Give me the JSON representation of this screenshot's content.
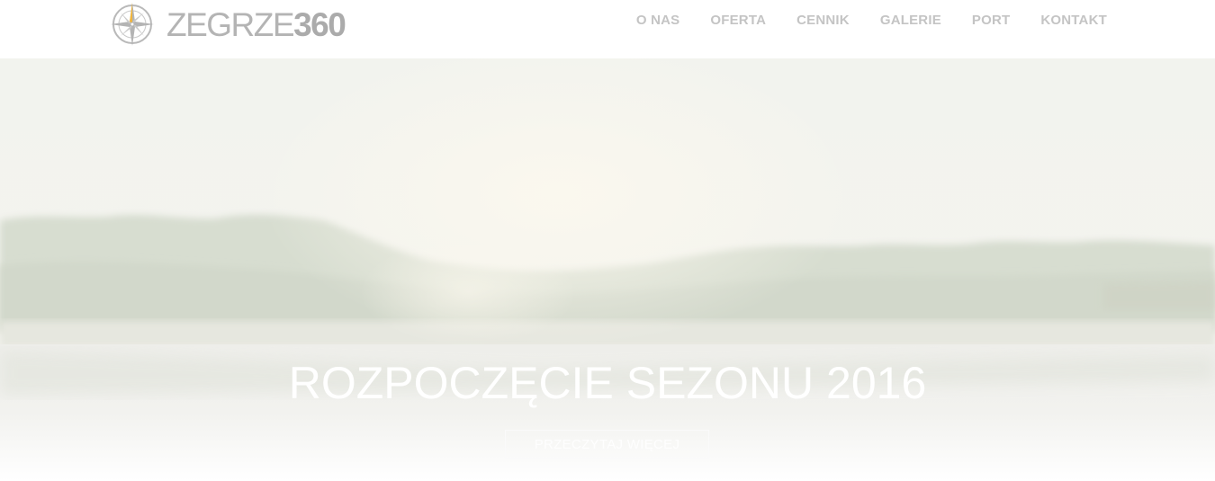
{
  "header": {
    "logo": {
      "text_light": "ZEGRZE",
      "text_bold": "360",
      "icon": "compass-rose-icon"
    },
    "nav": [
      {
        "label": "O NAS"
      },
      {
        "label": "OFERTA"
      },
      {
        "label": "CENNIK"
      },
      {
        "label": "GALERIE"
      },
      {
        "label": "PORT"
      },
      {
        "label": "KONTAKT"
      }
    ]
  },
  "hero": {
    "title": "ROZPOCZĘCIE SEZONU 2016",
    "button_label": "PRZECZYTAJ WIĘCEJ"
  },
  "colors": {
    "nav_text": "#c4c4c4",
    "logo_text": "#b4b4b4",
    "compass_accent": "#f2b53a",
    "hero_text": "#ffffff"
  }
}
